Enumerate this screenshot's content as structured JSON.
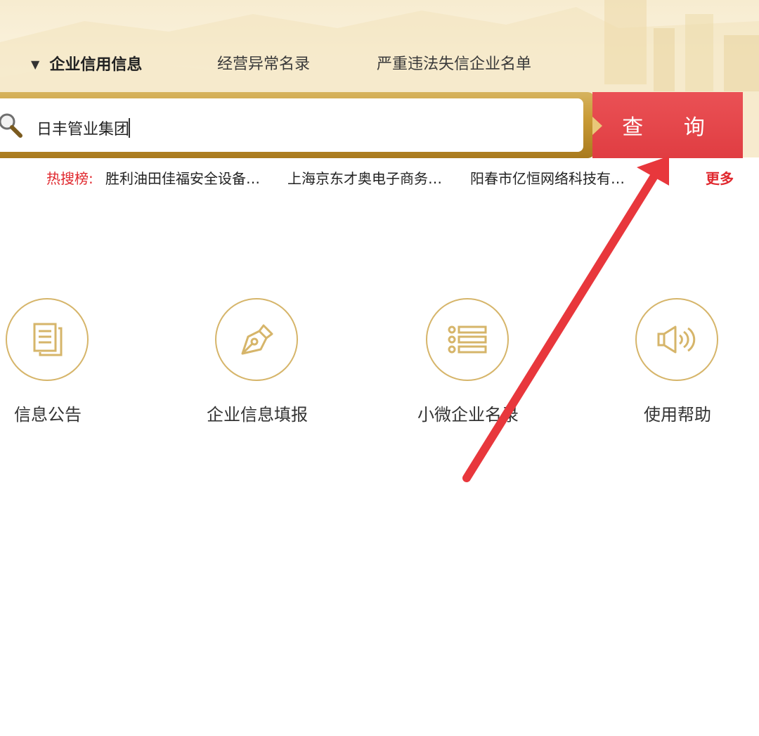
{
  "nav": {
    "tabs": [
      {
        "label": "企业信用信息",
        "active": true
      },
      {
        "label": "经营异常名录",
        "active": false
      },
      {
        "label": "严重违法失信企业名单",
        "active": false
      }
    ]
  },
  "search": {
    "value": "日丰管业集团",
    "button_label": "查 询"
  },
  "hot_list": {
    "label": "热搜榜:",
    "items": [
      "胜利油田佳福安全设备…",
      "上海京东才奥电子商务…",
      "阳春市亿恒网络科技有…"
    ],
    "more_label": "更多"
  },
  "features": [
    {
      "label": "信息公告",
      "icon": "document-icon"
    },
    {
      "label": "企业信息填报",
      "icon": "pen-icon"
    },
    {
      "label": "小微企业名录",
      "icon": "list-icon"
    },
    {
      "label": "使用帮助",
      "icon": "speaker-icon"
    }
  ],
  "colors": {
    "accent_red": "#e03d42",
    "gold": "#c99b36",
    "icon_gold": "#d6b56a"
  }
}
